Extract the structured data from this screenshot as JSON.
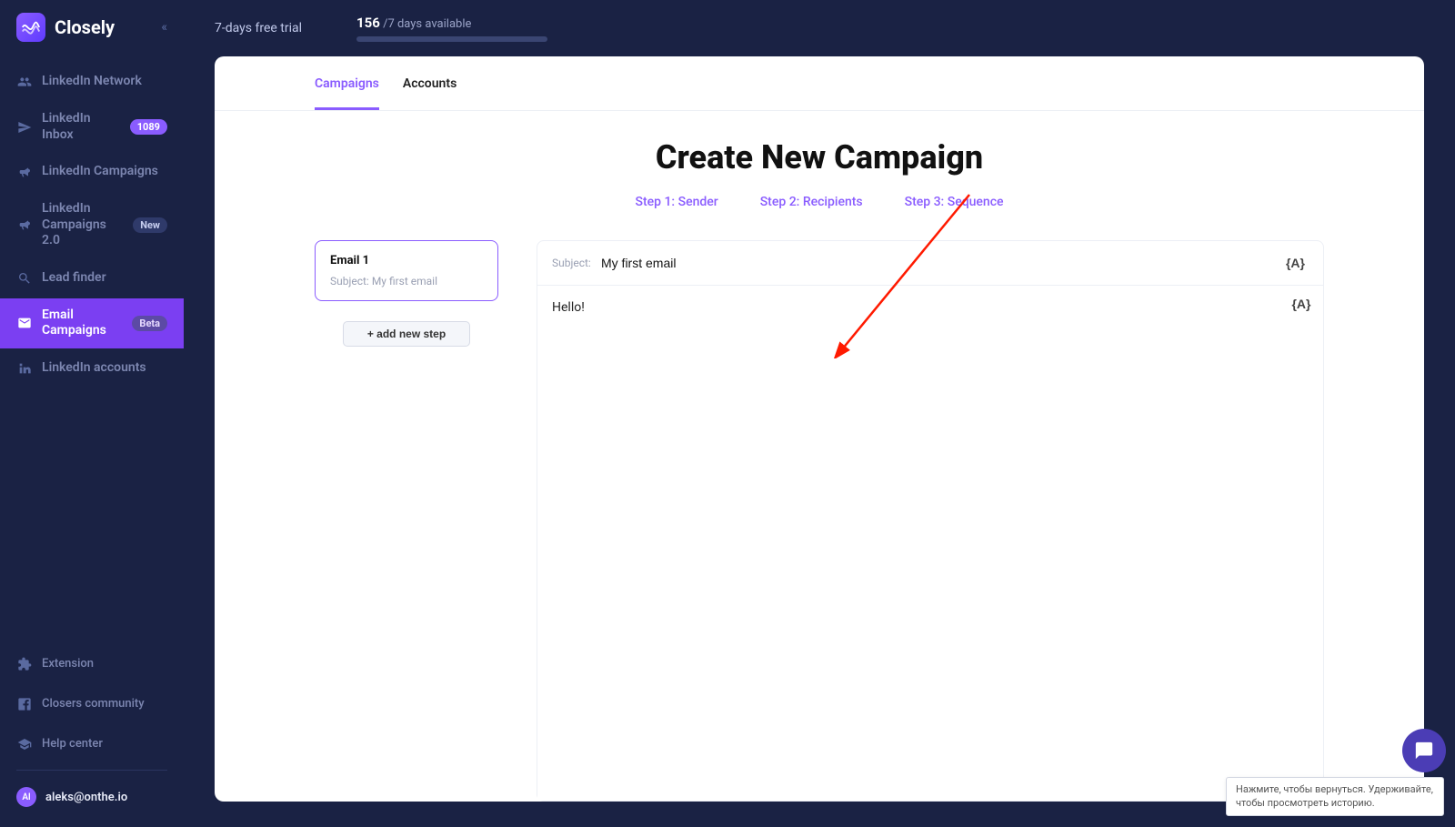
{
  "brand": {
    "name": "Closely"
  },
  "sidebar": {
    "nav": [
      {
        "label": "LinkedIn Network"
      },
      {
        "label": "LinkedIn Inbox",
        "badge": "1089"
      },
      {
        "label": "LinkedIn Campaigns"
      },
      {
        "label": "LinkedIn Campaigns 2.0",
        "badge": "New"
      },
      {
        "label": "Lead finder"
      },
      {
        "label": "Email Campaigns",
        "badge": "Beta"
      },
      {
        "label": "LinkedIn accounts"
      }
    ],
    "bottom": [
      {
        "label": "Extension"
      },
      {
        "label": "Closers community"
      },
      {
        "label": "Help center"
      }
    ],
    "user": {
      "initials": "Al",
      "email": "aleks@onthe.io"
    }
  },
  "topbar": {
    "trial": "7-days free trial",
    "days_num": "156",
    "days_rest": " /7 days available"
  },
  "tabs": {
    "campaigns": "Campaigns",
    "accounts": "Accounts"
  },
  "page": {
    "title": "Create New Campaign",
    "steps": [
      "Step 1: Sender",
      "Step 2: Recipients",
      "Step 3: Sequence"
    ]
  },
  "sequence": {
    "card_title": "Email 1",
    "card_subject_label": "Subject:",
    "card_subject_value": "My first email",
    "add_step": "+ add new step"
  },
  "composer": {
    "subject_label": "Subject:",
    "subject_value": "My first email",
    "body_value": "Hello!",
    "token": "{A}"
  },
  "tooltip": "Нажмите, чтобы вернуться. Удерживайте, чтобы просмотреть историю."
}
